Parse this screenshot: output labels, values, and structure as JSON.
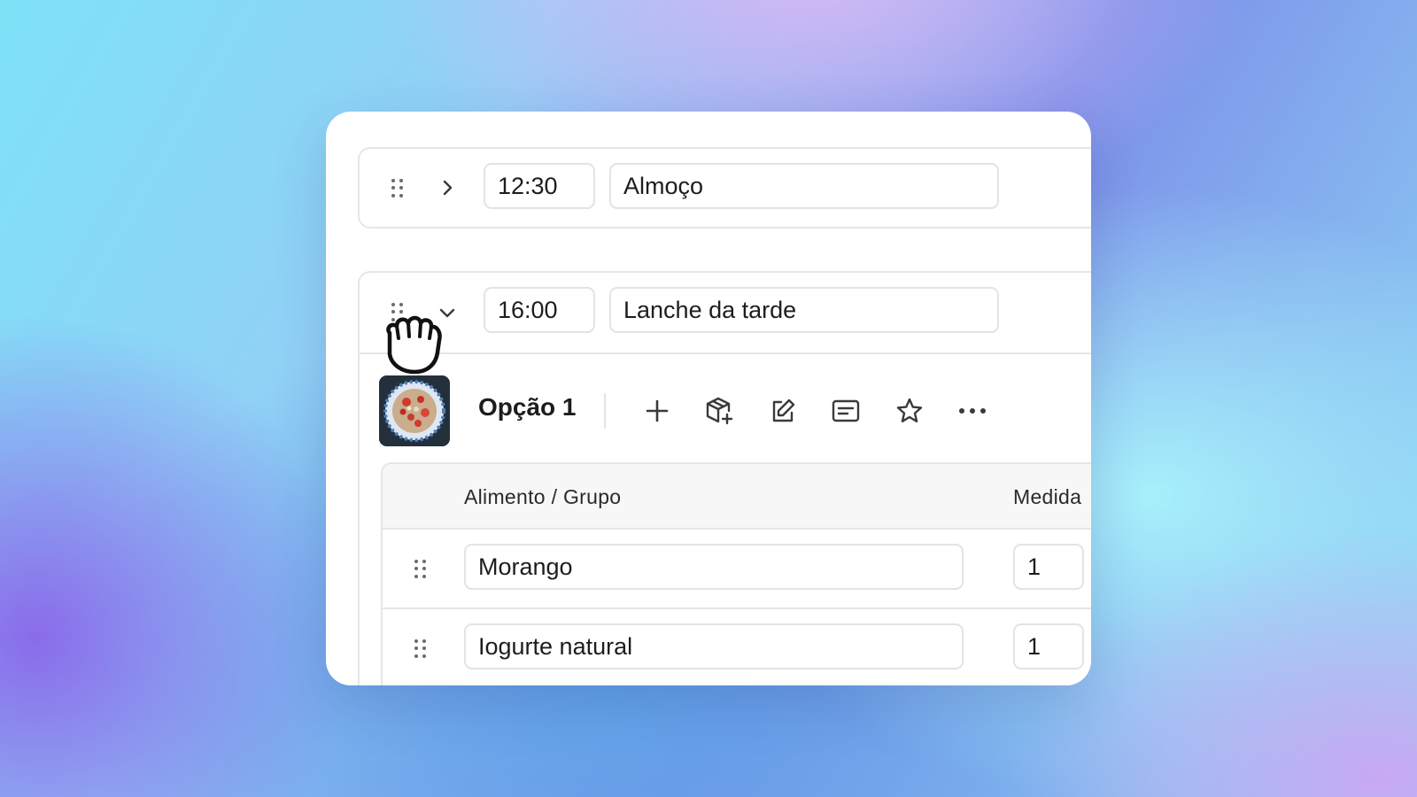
{
  "meals": [
    {
      "time": "12:30",
      "name": "Almoço",
      "expanded": false
    },
    {
      "time": "16:00",
      "name": "Lanche da tarde",
      "expanded": true
    }
  ],
  "option": {
    "title": "Opção 1",
    "toolbar": [
      "plus-icon",
      "package-add-icon",
      "edit-icon",
      "note-icon",
      "star-icon",
      "more-icon"
    ]
  },
  "table": {
    "headers": {
      "food": "Alimento / Grupo",
      "measure": "Medida"
    },
    "rows": [
      {
        "food": "Morango",
        "measure": "1"
      },
      {
        "food": "Iogurte natural",
        "measure": "1"
      }
    ]
  }
}
